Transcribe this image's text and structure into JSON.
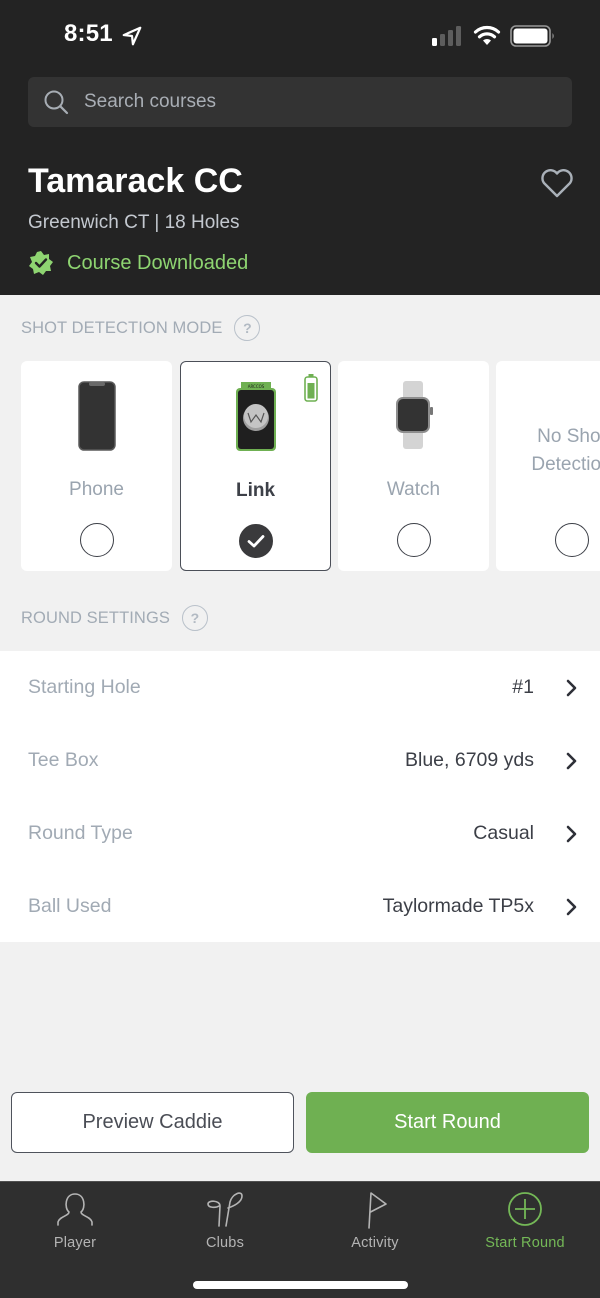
{
  "status_bar": {
    "time": "8:51",
    "location_icon": "location-arrow-icon",
    "signal_icon": "cellular-signal-icon",
    "wifi_icon": "wifi-icon",
    "battery_icon": "battery-icon"
  },
  "search": {
    "placeholder": "Search courses",
    "value": "",
    "icon": "search-icon"
  },
  "course": {
    "name": "Tamarack CC",
    "subtitle": "Greenwich CT | 18 Holes",
    "download_status": "Course Downloaded",
    "favorite_icon": "heart-outline-icon",
    "badge_icon": "verified-badge-icon"
  },
  "shot_detection": {
    "title": "SHOT DETECTION MODE",
    "help_label": "?",
    "options": [
      {
        "label": "Phone",
        "icon": "phone-icon",
        "selected": false
      },
      {
        "label": "Link",
        "icon": "arccos-link-icon",
        "selected": true,
        "device_brand": "ARCCOS"
      },
      {
        "label": "Watch",
        "icon": "watch-icon",
        "selected": false
      },
      {
        "label_line1": "No Shot",
        "label_line2": "Detection",
        "selected": false
      }
    ]
  },
  "round_settings": {
    "title": "ROUND SETTINGS",
    "help_label": "?",
    "rows": [
      {
        "label": "Starting Hole",
        "value": "#1"
      },
      {
        "label": "Tee Box",
        "value": "Blue, 6709 yds"
      },
      {
        "label": "Round Type",
        "value": "Casual"
      },
      {
        "label": "Ball Used",
        "value": "Taylormade TP5x"
      }
    ]
  },
  "actions": {
    "preview_label": "Preview Caddie",
    "start_label": "Start Round"
  },
  "tabbar": {
    "tabs": [
      {
        "label": "Player",
        "icon": "player-icon",
        "active": false
      },
      {
        "label": "Clubs",
        "icon": "clubs-icon",
        "active": false
      },
      {
        "label": "Activity",
        "icon": "flag-icon",
        "active": false
      },
      {
        "label": "Start Round",
        "icon": "plus-circle-icon",
        "active": true
      }
    ]
  },
  "colors": {
    "accent_green": "#6fb052",
    "downloaded_green": "#8ed471",
    "header_bg": "#232323",
    "tabbar_bg": "#2f2f2f"
  }
}
